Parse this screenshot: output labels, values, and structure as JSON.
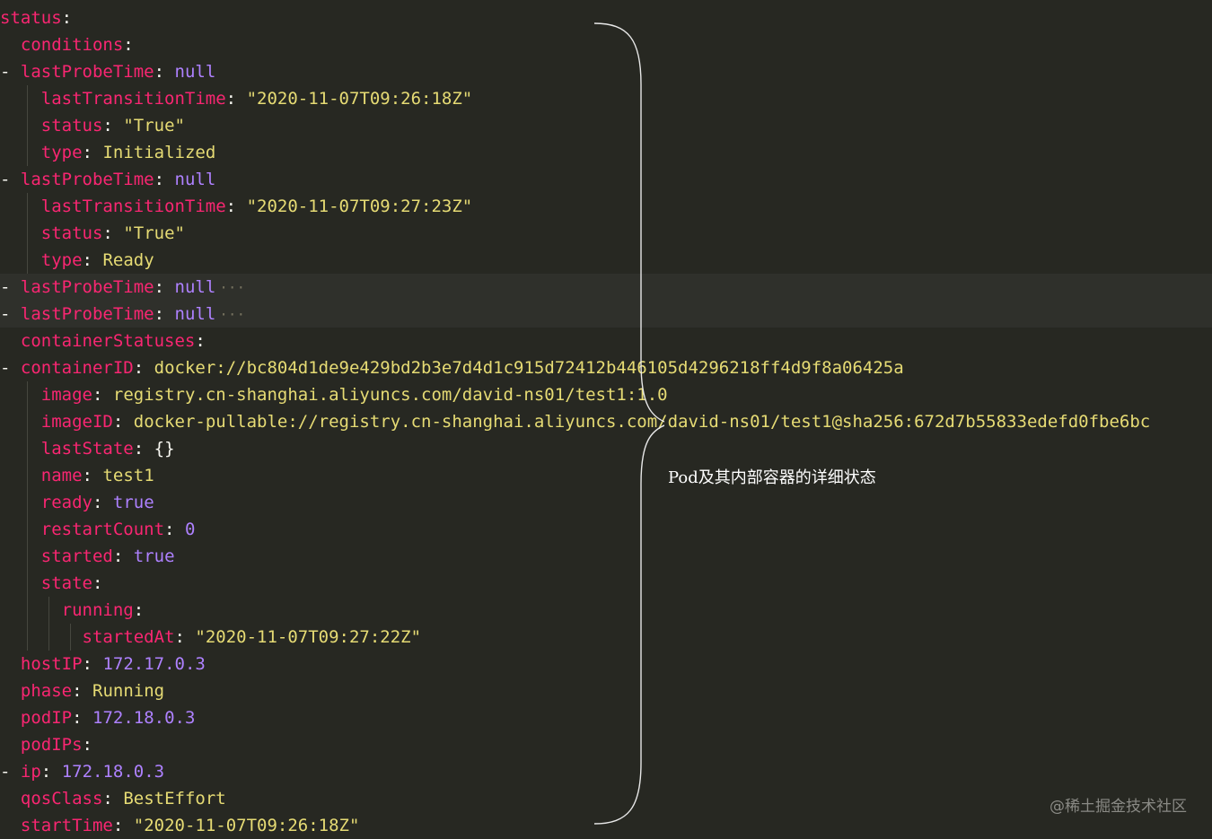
{
  "code_lines": [
    {
      "key": "status",
      "sep": ":",
      "value": "",
      "vtype": "",
      "prefix": "",
      "indent": 0
    },
    {
      "key": "conditions",
      "sep": ":",
      "value": "",
      "vtype": "",
      "prefix": "",
      "indent": 1
    },
    {
      "key": "lastProbeTime",
      "sep": ":",
      "value": "null",
      "vtype": "const",
      "prefix": "- ",
      "indent": 1
    },
    {
      "key": "lastTransitionTime",
      "sep": ":",
      "value": "\"2020-11-07T09:26:18Z\"",
      "vtype": "str",
      "prefix": "",
      "indent": 2
    },
    {
      "key": "status",
      "sep": ":",
      "value": "\"True\"",
      "vtype": "str",
      "prefix": "",
      "indent": 2
    },
    {
      "key": "type",
      "sep": ":",
      "value": "Initialized",
      "vtype": "str",
      "prefix": "",
      "indent": 2
    },
    {
      "key": "lastProbeTime",
      "sep": ":",
      "value": "null",
      "vtype": "const",
      "prefix": "- ",
      "indent": 1
    },
    {
      "key": "lastTransitionTime",
      "sep": ":",
      "value": "\"2020-11-07T09:27:23Z\"",
      "vtype": "str",
      "prefix": "",
      "indent": 2
    },
    {
      "key": "status",
      "sep": ":",
      "value": "\"True\"",
      "vtype": "str",
      "prefix": "",
      "indent": 2
    },
    {
      "key": "type",
      "sep": ":",
      "value": "Ready",
      "vtype": "str",
      "prefix": "",
      "indent": 2
    },
    {
      "key": "lastProbeTime",
      "sep": ":",
      "value": "null",
      "vtype": "const",
      "prefix": "- ",
      "indent": 1,
      "folded": true
    },
    {
      "key": "lastProbeTime",
      "sep": ":",
      "value": "null",
      "vtype": "const",
      "prefix": "- ",
      "indent": 1,
      "folded": true
    },
    {
      "key": "containerStatuses",
      "sep": ":",
      "value": "",
      "vtype": "",
      "prefix": "",
      "indent": 1
    },
    {
      "key": "containerID",
      "sep": ":",
      "value": "docker://bc804d1de9e429bd2b3e7d4d1c915d72412b446105d4296218ff4d9f8a06425a",
      "vtype": "str",
      "prefix": "- ",
      "indent": 1
    },
    {
      "key": "image",
      "sep": ":",
      "value": "registry.cn-shanghai.aliyuncs.com/david-ns01/test1:1.0",
      "vtype": "str",
      "prefix": "",
      "indent": 2
    },
    {
      "key": "imageID",
      "sep": ":",
      "value": "docker-pullable://registry.cn-shanghai.aliyuncs.com/david-ns01/test1@sha256:672d7b55833edefd0fbe6bc",
      "vtype": "str",
      "prefix": "",
      "indent": 2
    },
    {
      "key": "lastState",
      "sep": ":",
      "value": "{}",
      "vtype": "plain",
      "prefix": "",
      "indent": 2
    },
    {
      "key": "name",
      "sep": ":",
      "value": "test1",
      "vtype": "str",
      "prefix": "",
      "indent": 2
    },
    {
      "key": "ready",
      "sep": ":",
      "value": "true",
      "vtype": "const",
      "prefix": "",
      "indent": 2
    },
    {
      "key": "restartCount",
      "sep": ":",
      "value": "0",
      "vtype": "const",
      "prefix": "",
      "indent": 2
    },
    {
      "key": "started",
      "sep": ":",
      "value": "true",
      "vtype": "const",
      "prefix": "",
      "indent": 2
    },
    {
      "key": "state",
      "sep": ":",
      "value": "",
      "vtype": "",
      "prefix": "",
      "indent": 2
    },
    {
      "key": "running",
      "sep": ":",
      "value": "",
      "vtype": "",
      "prefix": "",
      "indent": 3
    },
    {
      "key": "startedAt",
      "sep": ":",
      "value": "\"2020-11-07T09:27:22Z\"",
      "vtype": "str",
      "prefix": "",
      "indent": 4
    },
    {
      "key": "hostIP",
      "sep": ":",
      "value": "172.17.0.3",
      "vtype": "const",
      "prefix": "",
      "indent": 1
    },
    {
      "key": "phase",
      "sep": ":",
      "value": "Running",
      "vtype": "str",
      "prefix": "",
      "indent": 1
    },
    {
      "key": "podIP",
      "sep": ":",
      "value": "172.18.0.3",
      "vtype": "const",
      "prefix": "",
      "indent": 1
    },
    {
      "key": "podIPs",
      "sep": ":",
      "value": "",
      "vtype": "",
      "prefix": "",
      "indent": 1
    },
    {
      "key": "ip",
      "sep": ":",
      "value": "172.18.0.3",
      "vtype": "const",
      "prefix": "- ",
      "indent": 1
    },
    {
      "key": "qosClass",
      "sep": ":",
      "value": "BestEffort",
      "vtype": "str",
      "prefix": "",
      "indent": 1
    },
    {
      "key": "startTime",
      "sep": ":",
      "value": "\"2020-11-07T09:26:18Z\"",
      "vtype": "str",
      "prefix": "",
      "indent": 1
    }
  ],
  "fold_marker": "···",
  "annotation": "Pod及其内部容器的详细状态",
  "watermark": "@稀土掘金技术社区",
  "colors": {
    "background": "#272822",
    "key": "#F92672",
    "string": "#E6DB74",
    "constant": "#AE81FF",
    "text": "#F8F8F2",
    "highlight": "#2F302B"
  }
}
